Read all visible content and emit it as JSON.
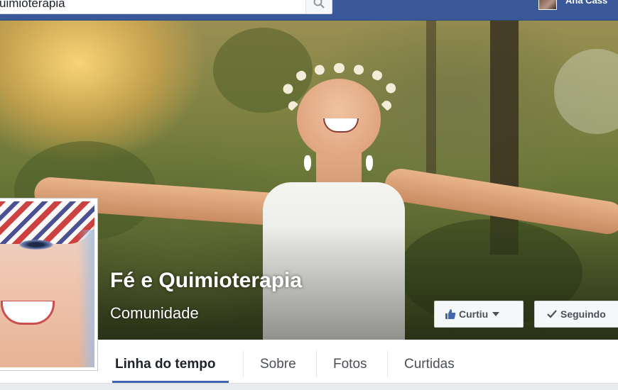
{
  "topbar": {
    "search_value": "uimioterapia",
    "user_name": "Ana Cass"
  },
  "page": {
    "title": "Fé e Quimioterapia",
    "category": "Comunidade"
  },
  "actions": {
    "liked_label": "Curtiu",
    "following_label": "Seguindo"
  },
  "tabs": [
    {
      "label": "Linha do tempo",
      "active": true
    },
    {
      "label": "Sobre"
    },
    {
      "label": "Fotos"
    },
    {
      "label": "Curtidas"
    }
  ],
  "colors": {
    "brand": "#3b5998",
    "link": "#4267b2"
  },
  "icons": {
    "search": "search-icon",
    "like": "thumbs-up-icon",
    "check": "checkmark-icon",
    "dropdown": "chevron-down-icon"
  }
}
